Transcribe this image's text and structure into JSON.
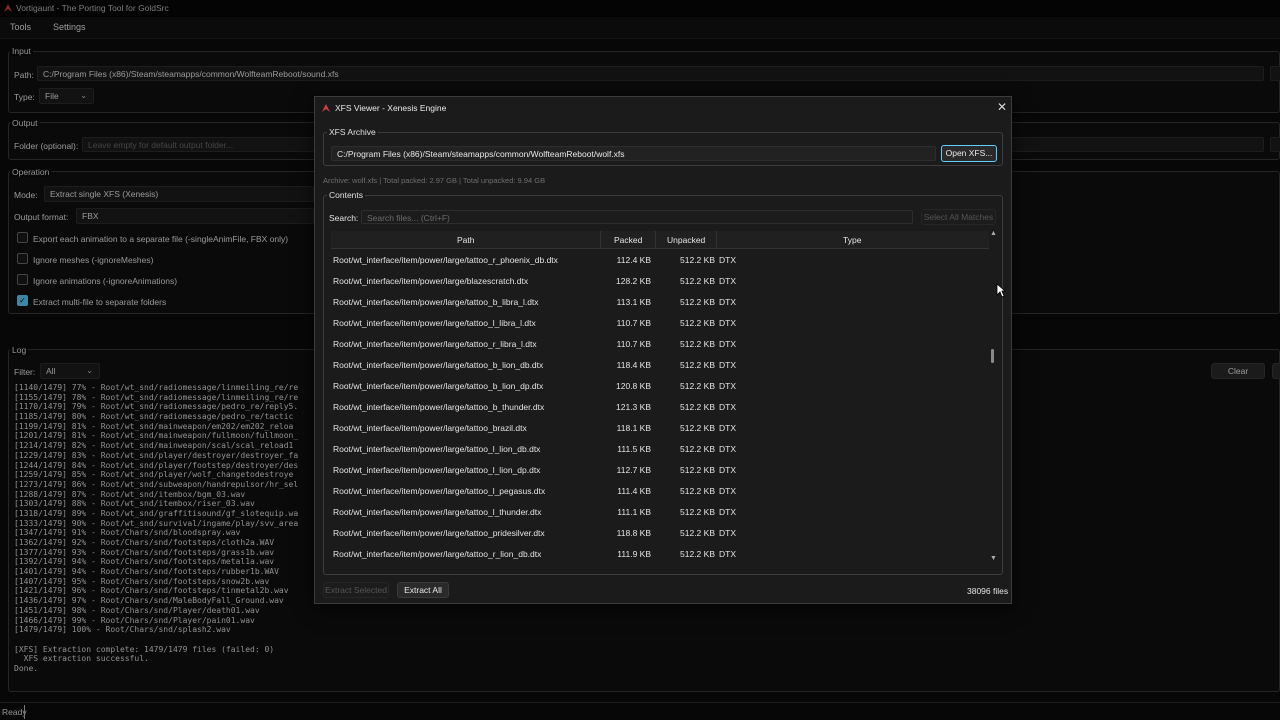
{
  "window": {
    "title": "Vortigaunt - The Porting Tool for GoldSrc"
  },
  "menu": {
    "tools": "Tools",
    "settings": "Settings"
  },
  "input": {
    "group_label": "Input",
    "path_label": "Path:",
    "path_value": "C:/Program Files (x86)/Steam/steamapps/common/WolfteamReboot/sound.xfs",
    "type_label": "Type:",
    "type_value": "File"
  },
  "output": {
    "group_label": "Output",
    "folder_label": "Folder (optional):",
    "folder_placeholder": "Leave empty for default output folder..."
  },
  "operation": {
    "group_label": "Operation",
    "mode_label": "Mode:",
    "mode_value": "Extract single XFS (Xenesis)",
    "format_label": "Output format:",
    "format_value": "FBX",
    "options": [
      {
        "label": "Export each animation to a separate file (-singleAnimFile, FBX only)",
        "checked": false
      },
      {
        "label": "Ignore meshes (-ignoreMeshes)",
        "checked": false
      },
      {
        "label": "Ignore animations (-ignoreAnimations)",
        "checked": false
      },
      {
        "label": "Extract multi-file to separate folders",
        "checked": true
      }
    ]
  },
  "log": {
    "group_label": "Log",
    "filter_label": "Filter:",
    "filter_value": "All",
    "clear_label": "Clear",
    "lines": [
      "[1140/1479] 77% - Root/wt_snd/radiomessage/linmeiling_re/re",
      "[1155/1479] 78% - Root/wt_snd/radiomessage/linmeiling_re/re",
      "[1170/1479] 79% - Root/wt_snd/radiomessage/pedro_re/reply5.",
      "[1185/1479] 80% - Root/wt_snd/radiomessage/pedro_re/tactic",
      "[1199/1479] 81% - Root/wt_snd/mainweapon/em202/em202_reloa",
      "[1201/1479] 81% - Root/wt_snd/mainweapon/fullmoon/fullmoon_",
      "[1214/1479] 82% - Root/wt_snd/mainweapon/scal/scal_reload1",
      "[1229/1479] 83% - Root/wt_snd/player/destroyer/destroyer_fa",
      "[1244/1479] 84% - Root/wt_snd/player/footstep/destroyer/des",
      "[1259/1479] 85% - Root/wt_snd/player/wolf_changetodestroye",
      "[1273/1479] 86% - Root/wt_snd/subweapon/handrepulsor/hr_sel",
      "[1288/1479] 87% - Root/wt_snd/itembox/bgm_03.wav",
      "[1303/1479] 88% - Root/wt_snd/itembox/riser_03.wav",
      "[1318/1479] 89% - Root/wt_snd/graffitisound/gf_slotequip.wa",
      "[1333/1479] 90% - Root/wt_snd/survival/ingame/play/svv_area",
      "[1347/1479] 91% - Root/Chars/snd/bloodspray.wav",
      "[1362/1479] 92% - Root/Chars/snd/footsteps/cloth2a.WAV",
      "[1377/1479] 93% - Root/Chars/snd/footsteps/grass1b.wav",
      "[1392/1479] 94% - Root/Chars/snd/footsteps/metal1a.wav",
      "[1401/1479] 94% - Root/Chars/snd/footsteps/rubber1b.WAV",
      "[1407/1479] 95% - Root/Chars/snd/footsteps/snow2b.wav",
      "[1421/1479] 96% - Root/Chars/snd/footsteps/tinmetal2b.wav",
      "[1436/1479] 97% - Root/Chars/snd/MaleBodyFall_Ground.wav",
      "[1451/1479] 98% - Root/Chars/snd/Player/death01.wav",
      "[1466/1479] 99% - Root/Chars/snd/Player/pain01.wav",
      "[1479/1479] 100% - Root/Chars/snd/splash2.wav",
      "",
      "[XFS] Extraction complete: 1479/1479 files (failed: 0)",
      "  XFS extraction successful.",
      "Done."
    ]
  },
  "status": {
    "text": "Ready"
  },
  "dialog": {
    "title": "XFS Viewer - Xenesis Engine",
    "archive_group_label": "XFS Archive",
    "archive_path": "C:/Program Files (x86)/Steam/steamapps/common/WolfteamReboot/wolf.xfs",
    "open_button": "Open XFS...",
    "archive_info": "Archive: wolf.xfs | Total packed: 2.97 GB | Total unpacked: 9.94 GB",
    "contents_group_label": "Contents",
    "search_label": "Search:",
    "search_placeholder": "Search files... (Ctrl+F)",
    "select_all_button": "Select All Matches",
    "columns": {
      "path": "Path",
      "packed": "Packed",
      "unpacked": "Unpacked",
      "type": "Type"
    },
    "rows": [
      {
        "path": "Root/wt_interface/item/power/large/tattoo_r_phoenix_db.dtx",
        "packed": "112.4 KB",
        "unpacked": "512.2 KB",
        "type": "DTX"
      },
      {
        "path": "Root/wt_interface/item/power/large/blazescratch.dtx",
        "packed": "128.2 KB",
        "unpacked": "512.2 KB",
        "type": "DTX"
      },
      {
        "path": "Root/wt_interface/item/power/large/tattoo_b_libra_l.dtx",
        "packed": "113.1 KB",
        "unpacked": "512.2 KB",
        "type": "DTX"
      },
      {
        "path": "Root/wt_interface/item/power/large/tattoo_l_libra_l.dtx",
        "packed": "110.7 KB",
        "unpacked": "512.2 KB",
        "type": "DTX"
      },
      {
        "path": "Root/wt_interface/item/power/large/tattoo_r_libra_l.dtx",
        "packed": "110.7 KB",
        "unpacked": "512.2 KB",
        "type": "DTX"
      },
      {
        "path": "Root/wt_interface/item/power/large/tattoo_b_lion_db.dtx",
        "packed": "118.4 KB",
        "unpacked": "512.2 KB",
        "type": "DTX"
      },
      {
        "path": "Root/wt_interface/item/power/large/tattoo_b_lion_dp.dtx",
        "packed": "120.8 KB",
        "unpacked": "512.2 KB",
        "type": "DTX"
      },
      {
        "path": "Root/wt_interface/item/power/large/tattoo_b_thunder.dtx",
        "packed": "121.3 KB",
        "unpacked": "512.2 KB",
        "type": "DTX"
      },
      {
        "path": "Root/wt_interface/item/power/large/tattoo_brazil.dtx",
        "packed": "118.1 KB",
        "unpacked": "512.2 KB",
        "type": "DTX"
      },
      {
        "path": "Root/wt_interface/item/power/large/tattoo_l_lion_db.dtx",
        "packed": "111.5 KB",
        "unpacked": "512.2 KB",
        "type": "DTX"
      },
      {
        "path": "Root/wt_interface/item/power/large/tattoo_l_lion_dp.dtx",
        "packed": "112.7 KB",
        "unpacked": "512.2 KB",
        "type": "DTX"
      },
      {
        "path": "Root/wt_interface/item/power/large/tattoo_l_pegasus.dtx",
        "packed": "111.4 KB",
        "unpacked": "512.2 KB",
        "type": "DTX"
      },
      {
        "path": "Root/wt_interface/item/power/large/tattoo_l_thunder.dtx",
        "packed": "111.1 KB",
        "unpacked": "512.2 KB",
        "type": "DTX"
      },
      {
        "path": "Root/wt_interface/item/power/large/tattoo_pridesilver.dtx",
        "packed": "118.8 KB",
        "unpacked": "512.2 KB",
        "type": "DTX"
      },
      {
        "path": "Root/wt_interface/item/power/large/tattoo_r_lion_db.dtx",
        "packed": "111.9 KB",
        "unpacked": "512.2 KB",
        "type": "DTX"
      }
    ],
    "extract_selected_button": "Extract Selected",
    "extract_all_button": "Extract All",
    "file_count": "38096 files"
  },
  "colors": {
    "accent": "#60cdff",
    "background": "#0c0c0c",
    "dialog": "#1b1b1b"
  },
  "icons": {
    "app": "vortigaunt-logo-icon",
    "close": "close-icon",
    "chevron": "chevron-down-icon",
    "check": "checkmark-icon"
  }
}
